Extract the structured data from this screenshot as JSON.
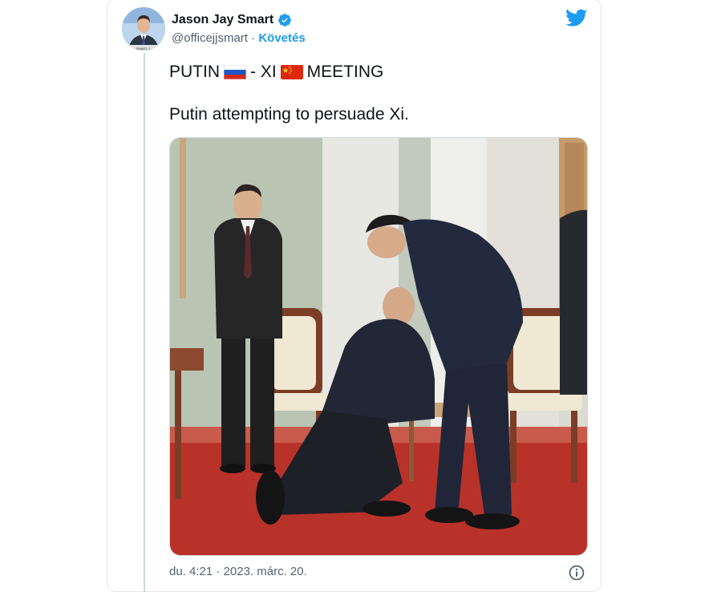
{
  "author": {
    "display_name": "Jason Jay Smart",
    "handle": "@officejjsmart",
    "separator": " · ",
    "follow_label": "Követés",
    "avatar_caption": "SMART, J."
  },
  "tweet": {
    "line1_part1": "PUTIN",
    "line1_part2": "- XI",
    "line1_part3": "MEETING",
    "line2": "Putin attempting to persuade Xi."
  },
  "footer": {
    "timestamp": "du. 4:21 · 2023. márc. 20."
  },
  "icons": {
    "verified": "verified-badge-icon",
    "brand": "twitter-bird-icon",
    "flag_ru": "russia-flag-icon",
    "flag_cn": "china-flag-icon",
    "info": "info-icon"
  },
  "colors": {
    "accent": "#1d9bf0",
    "muted_text": "#536471",
    "text": "#0f1419",
    "border": "#cfd9de"
  }
}
